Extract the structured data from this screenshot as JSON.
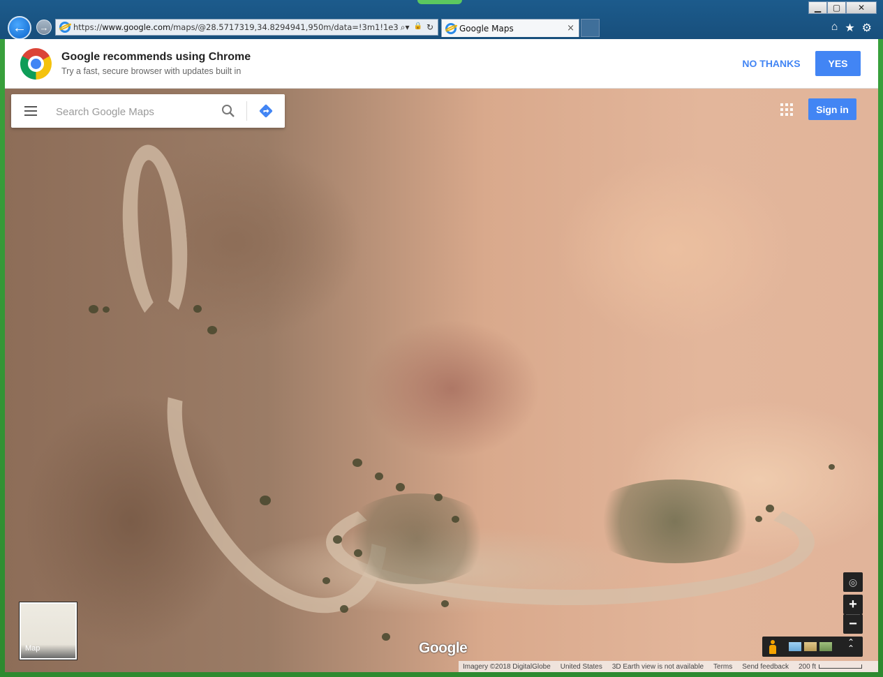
{
  "browser": {
    "url_prefix": "https://",
    "url_domain": "www.google.com",
    "url_rest": "/maps/@28.5717319,34.8294941,950m/data=!3m1!1e3",
    "tab_title": "Google Maps",
    "tab_close": "×",
    "window_controls": {
      "minimize": "▁",
      "maximize": "▢",
      "close": "✕"
    },
    "nav": {
      "back": "←",
      "forward": "→"
    },
    "addr_icons": {
      "search": "⌕▾",
      "lock": "🔒",
      "refresh": "↻"
    },
    "cmd_icons": {
      "home": "⌂",
      "favorites": "★",
      "settings": "⚙"
    }
  },
  "banner": {
    "title": "Google recommends using Chrome",
    "subtitle": "Try a fast, secure browser with updates built in",
    "no_thanks": "NO THANKS",
    "yes": "YES"
  },
  "maps": {
    "search_placeholder": "Search Google Maps",
    "sign_in": "Sign in",
    "minimap_label": "Map",
    "logo": "Google",
    "zoom_in": "+",
    "zoom_out": "−",
    "locate": "◎",
    "chevrons": "⌃",
    "attribution": {
      "imagery": "Imagery ©2018 DigitalGlobe",
      "region": "United States",
      "earth": "3D Earth view is not available",
      "terms": "Terms",
      "feedback": "Send feedback",
      "scale": "200 ft"
    }
  },
  "colors": {
    "frame_green": "#2d8a2f",
    "ie_blue": "#184f7c",
    "google_blue": "#4285f4"
  }
}
